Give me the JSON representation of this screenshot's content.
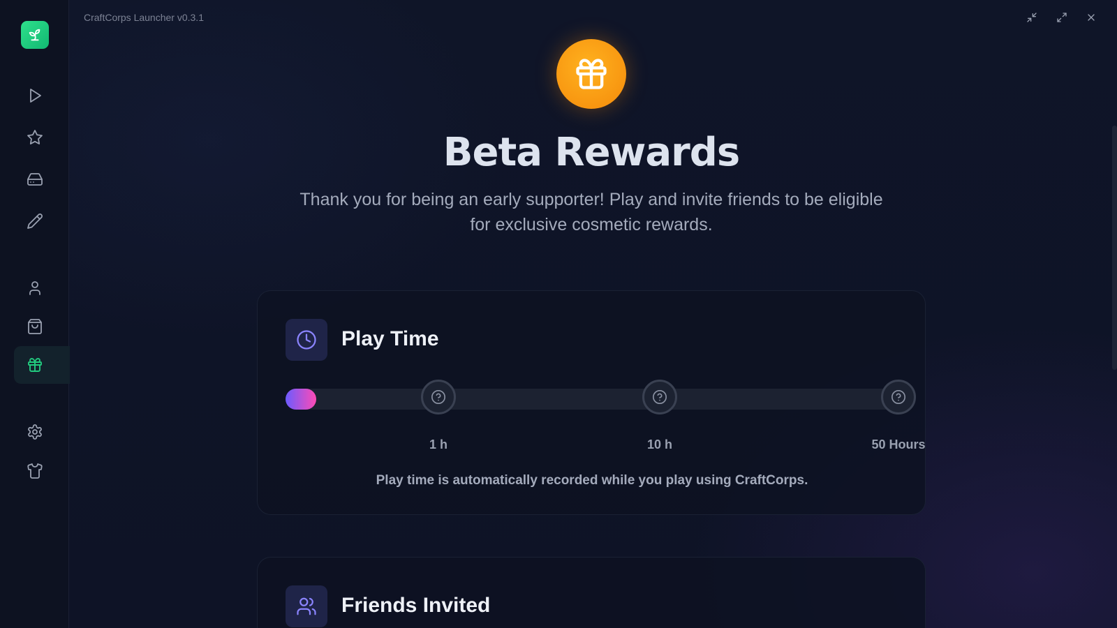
{
  "window": {
    "title": "CraftCorps Launcher v0.3.1",
    "controls": [
      "minimize-icon",
      "maximize-icon",
      "close-icon"
    ]
  },
  "sidebar": {
    "logo_icon": "sprout-icon",
    "items": [
      {
        "id": "play",
        "icon": "play-icon",
        "active": false
      },
      {
        "id": "favorites",
        "icon": "star-icon",
        "active": false
      },
      {
        "id": "storage",
        "icon": "drive-icon",
        "active": false
      },
      {
        "id": "editor",
        "icon": "pencil-icon",
        "active": false
      },
      {
        "id": "profile",
        "icon": "user-icon",
        "active": false
      },
      {
        "id": "store",
        "icon": "shopping-bag-icon",
        "active": false
      },
      {
        "id": "rewards",
        "icon": "gift-icon",
        "active": true
      },
      {
        "id": "settings",
        "icon": "gear-icon",
        "active": false
      },
      {
        "id": "cosmetics",
        "icon": "shirt-icon",
        "active": false
      }
    ]
  },
  "hero": {
    "icon": "gift-icon",
    "title": "Beta Rewards",
    "subtitle": "Thank you for being an early supporter! Play and invite friends to be eligible for exclusive cosmetic rewards."
  },
  "play_time": {
    "icon": "clock-icon",
    "title": "Play Time",
    "progress_fraction": 0.03,
    "milestones": [
      {
        "label": "1 h",
        "icon": "question-icon"
      },
      {
        "label": "10 h",
        "icon": "question-icon"
      },
      {
        "label": "50 Hours",
        "icon": "question-icon"
      }
    ],
    "note": "Play time is automatically recorded while you play using CraftCorps."
  },
  "friends_invited": {
    "icon": "users-icon",
    "title": "Friends Invited"
  },
  "colors": {
    "accent_green": "#22c97e",
    "gift_orange": "#f7950f",
    "progress_start": "#6b5bff",
    "progress_end": "#ff4bb5",
    "card_icon_bg": "#1f2448"
  }
}
